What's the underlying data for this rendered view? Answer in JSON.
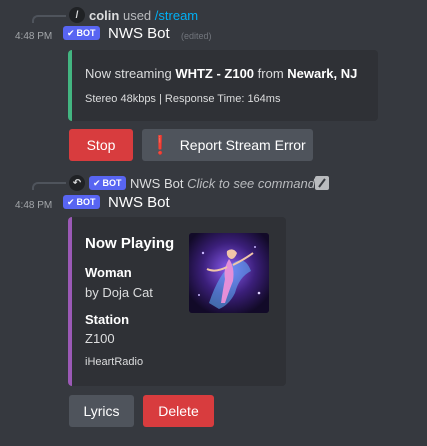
{
  "message1": {
    "reply": {
      "user": "colin",
      "used_text": "used",
      "command": "/stream",
      "avatar_letter": "/"
    },
    "timestamp": "4:48 PM",
    "bot_badge": "BOT",
    "author": "NWS Bot",
    "edited": "(edited)",
    "embed": {
      "line_prefix": "Now streaming ",
      "station": "WHTZ - Z100",
      "line_mid": " from ",
      "location": "Newark, NJ",
      "subline": "Stereo 48kbps | Response Time: 164ms",
      "accent_color": "#43b581"
    },
    "buttons": {
      "stop_label": "Stop",
      "report_label": "Report Stream Error",
      "report_icon": "exclamation-icon"
    }
  },
  "message2": {
    "reply": {
      "bot_badge": "BOT",
      "author": "NWS Bot",
      "hint": "Click to see command"
    },
    "timestamp": "4:48 PM",
    "bot_badge": "BOT",
    "author": "NWS Bot",
    "embed": {
      "title": "Now Playing",
      "song": "Woman",
      "artist": "by Doja Cat",
      "station_label": "Station",
      "station_value": "Z100",
      "footer": "iHeartRadio",
      "accent_color": "#9b59b6"
    },
    "buttons": {
      "lyrics_label": "Lyrics",
      "delete_label": "Delete"
    }
  },
  "colors": {
    "background": "#36393f",
    "embed_bg": "#2f3136",
    "blurple": "#5865f2",
    "danger": "#d83c3e",
    "secondary": "#4f545c",
    "link": "#00aff4"
  }
}
